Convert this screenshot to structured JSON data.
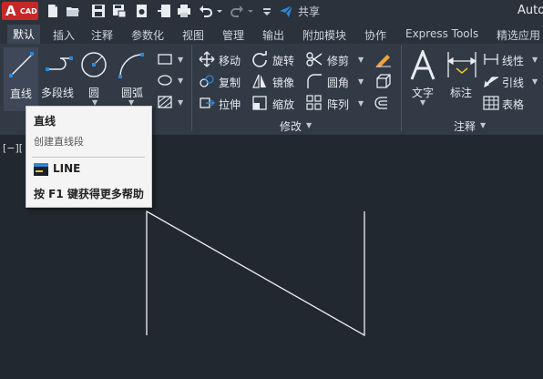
{
  "app": {
    "logo_letter": "A",
    "logo_badge": "CAD",
    "title_fragment": "Auto"
  },
  "quick_access": {
    "share_label": "共享"
  },
  "tabs": [
    {
      "label": "默认",
      "active": true
    },
    {
      "label": "插入"
    },
    {
      "label": "注释"
    },
    {
      "label": "参数化"
    },
    {
      "label": "视图"
    },
    {
      "label": "管理"
    },
    {
      "label": "输出"
    },
    {
      "label": "附加模块"
    },
    {
      "label": "协作"
    },
    {
      "label": "Express Tools"
    },
    {
      "label": "精选应用"
    }
  ],
  "draw_panel": {
    "line_label": "直线",
    "polyline_label": "多段线",
    "circle_label": "圆",
    "arc_label": "圆弧"
  },
  "modify_panel": {
    "title": "修改",
    "move": "移动",
    "rotate": "旋转",
    "trim": "修剪",
    "copy": "复制",
    "mirror": "镜像",
    "fillet": "圆角",
    "stretch": "拉伸",
    "scale": "缩放",
    "array": "阵列"
  },
  "annotation_panel": {
    "title": "注释",
    "text": "文字",
    "dimension": "标注",
    "linear": "线性",
    "leader": "引线",
    "table": "表格"
  },
  "viewport": {
    "label": "[−]["
  },
  "tooltip": {
    "title": "直线",
    "description": "创建直线段",
    "command": "LINE",
    "help": "按 F1 键获得更多帮助"
  },
  "colors": {
    "accent": "#2f86d6",
    "brand": "#c62828",
    "background": "#212830",
    "ribbon": "#323a46"
  }
}
